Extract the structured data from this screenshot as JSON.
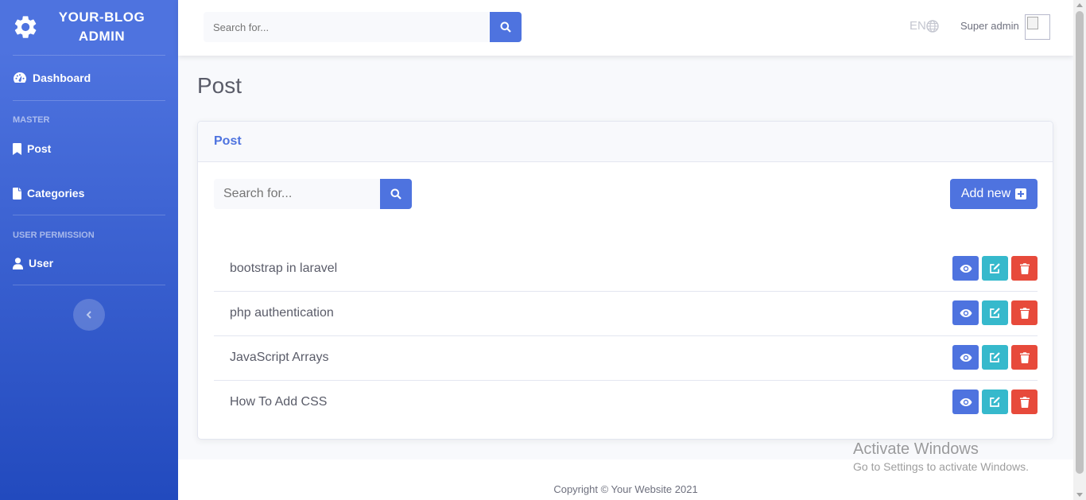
{
  "sidebar": {
    "brand_line1": "YOUR-BLOG",
    "brand_line2": "ADMIN",
    "brand_icon": "gear-icon",
    "dashboard_label": "Dashboard",
    "heading_master": "MASTER",
    "post_label": "Post",
    "categories_label": "Categories",
    "heading_user_permission": "USER PERMISSION",
    "user_label": "User",
    "toggle_icon": "chevron-left-icon"
  },
  "topbar": {
    "search_placeholder": "Search for...",
    "lang": "EN",
    "user_name": "Super admin"
  },
  "main": {
    "page_title": "Post",
    "card_title": "Post",
    "search_placeholder": "Search for...",
    "add_label": "Add new",
    "posts": [
      {
        "title": "bootstrap in laravel"
      },
      {
        "title": "php authentication"
      },
      {
        "title": "JavaScript Arrays"
      },
      {
        "title": "How To Add CSS"
      }
    ]
  },
  "footer": {
    "copyright": "Copyright © Your Website 2021"
  },
  "watermark": {
    "title": "Activate Windows",
    "subtitle": "Go to Settings to activate Windows."
  },
  "colors": {
    "primary": "#4e73df",
    "info": "#36b9cc",
    "danger": "#e74a3b"
  }
}
